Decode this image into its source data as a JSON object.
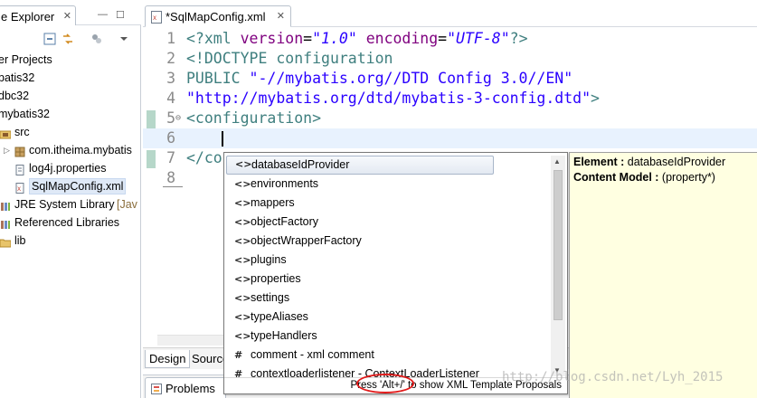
{
  "explorer": {
    "tab_label": "e Explorer",
    "tree": [
      {
        "label": "er Projects",
        "indent": 0,
        "icon": "none"
      },
      {
        "label": "batis32",
        "indent": 0,
        "icon": "none"
      },
      {
        "label": "dbc32",
        "indent": 0,
        "icon": "none"
      },
      {
        "label": "mybatis32",
        "indent": 0,
        "icon": "none"
      },
      {
        "label": "src",
        "indent": 1,
        "icon": "package-folder-icon"
      },
      {
        "label": "com.itheima.mybatis",
        "indent": 2,
        "icon": "package-icon"
      },
      {
        "label": "log4j.properties",
        "indent": 2,
        "icon": "file-icon"
      },
      {
        "label": "SqlMapConfig.xml",
        "indent": 2,
        "icon": "xml-file-icon",
        "selected": true
      },
      {
        "label": "JRE System Library",
        "extra": "[Jav",
        "indent": 1,
        "icon": "library-icon"
      },
      {
        "label": "Referenced Libraries",
        "indent": 1,
        "icon": "library-icon"
      },
      {
        "label": "lib",
        "indent": 1,
        "icon": "folder-icon"
      }
    ]
  },
  "editor": {
    "tab_label": "*SqlMapConfig.xml",
    "lines": [
      {
        "num": "1",
        "tokens": [
          [
            "c-pi",
            "<?xml "
          ],
          [
            "c-attr",
            "version"
          ],
          [
            "",
            "="
          ],
          [
            "c-val",
            "\"1.0\""
          ],
          [
            "",
            ""
          ],
          [
            "c-attr",
            " encoding"
          ],
          [
            "",
            "="
          ],
          [
            "c-val",
            "\"UTF-8\""
          ],
          [
            "c-pi",
            "?>"
          ]
        ]
      },
      {
        "num": "2",
        "tokens": [
          [
            "c-dtd",
            "<!DOCTYPE configuration"
          ]
        ]
      },
      {
        "num": "3",
        "tokens": [
          [
            "c-dtd",
            "PUBLIC "
          ],
          [
            "c-str",
            "\"-//mybatis.org//DTD Config 3.0//EN\""
          ]
        ]
      },
      {
        "num": "4",
        "tokens": [
          [
            "c-str",
            "\"http://mybatis.org/dtd/mybatis-3-config.dtd\""
          ],
          [
            "c-dtd",
            ">"
          ]
        ]
      },
      {
        "num": "5",
        "fold": true,
        "tokens": [
          [
            "c-tag",
            "<configuration>"
          ]
        ]
      },
      {
        "num": "6",
        "current": true,
        "tokens": []
      },
      {
        "num": "7",
        "tokens": [
          [
            "c-tag",
            "</co"
          ]
        ]
      },
      {
        "num": "8",
        "tokens": []
      }
    ],
    "bottom_tabs": [
      "Design",
      "Source"
    ],
    "problems_label": "Problems"
  },
  "assist": {
    "proposals": [
      {
        "icon": "<>",
        "label": "databaseIdProvider",
        "selected": true
      },
      {
        "icon": "<>",
        "label": "environments"
      },
      {
        "icon": "<>",
        "label": "mappers"
      },
      {
        "icon": "<>",
        "label": "objectFactory"
      },
      {
        "icon": "<>",
        "label": "objectWrapperFactory"
      },
      {
        "icon": "<>",
        "label": "plugins"
      },
      {
        "icon": "<>",
        "label": "properties"
      },
      {
        "icon": "<>",
        "label": "settings"
      },
      {
        "icon": "<>",
        "label": "typeAliases"
      },
      {
        "icon": "<>",
        "label": "typeHandlers"
      },
      {
        "icon": "#",
        "label": "comment - xml comment"
      },
      {
        "icon": "#",
        "label": "contextloaderlistener - ContextLoaderListener"
      }
    ],
    "status": "Press 'Alt+/' to show XML Template Proposals"
  },
  "info": {
    "element_label": "Element :",
    "element_value": "databaseIdProvider",
    "content_label": "Content Model :",
    "content_value": "(property*)"
  },
  "watermark": "http://blog.csdn.net/Lyh_2015"
}
